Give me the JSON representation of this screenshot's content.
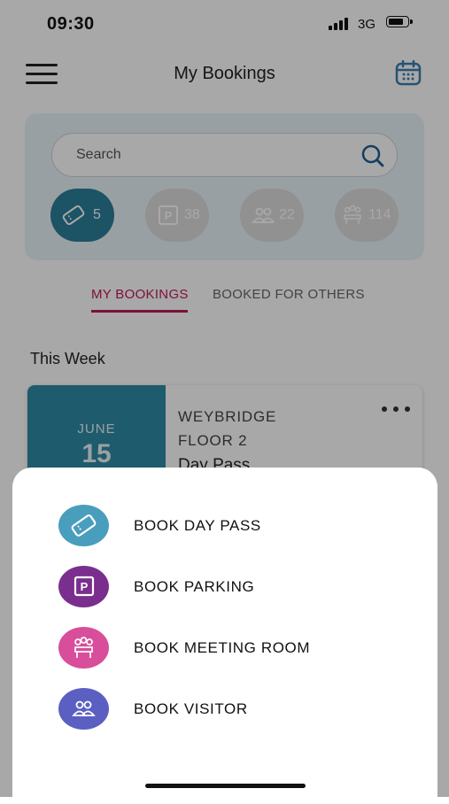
{
  "status_bar": {
    "time": "09:30",
    "network": "3G"
  },
  "header": {
    "title": "My Bookings"
  },
  "search": {
    "placeholder": "Search"
  },
  "filters": [
    {
      "icon": "ticket-icon",
      "count": "5",
      "active": true
    },
    {
      "icon": "parking-icon",
      "count": "38",
      "active": false
    },
    {
      "icon": "visitors-icon",
      "count": "22",
      "active": false
    },
    {
      "icon": "meeting-room-icon",
      "count": "114",
      "active": false
    }
  ],
  "tabs": {
    "my_bookings": "MY BOOKINGS",
    "booked_for_others": "BOOKED FOR OTHERS"
  },
  "section_title": "This Week",
  "booking": {
    "month": "JUNE",
    "day": "15",
    "location": "WEYBRIDGE",
    "floor": "FLOOR 2",
    "type": "Day Pass"
  },
  "actions": [
    {
      "label": "BOOK DAY PASS",
      "icon": "ticket-icon",
      "color": "#4a9ebd"
    },
    {
      "label": "BOOK PARKING",
      "icon": "parking-icon",
      "color": "#7a2e8e"
    },
    {
      "label": "BOOK MEETING ROOM",
      "icon": "meeting-room-icon",
      "color": "#d84e9a"
    },
    {
      "label": "BOOK VISITOR",
      "icon": "visitors-icon",
      "color": "#5b5fc2"
    }
  ],
  "colors": {
    "accent": "#c0185a",
    "primary": "#2e8aa5"
  }
}
